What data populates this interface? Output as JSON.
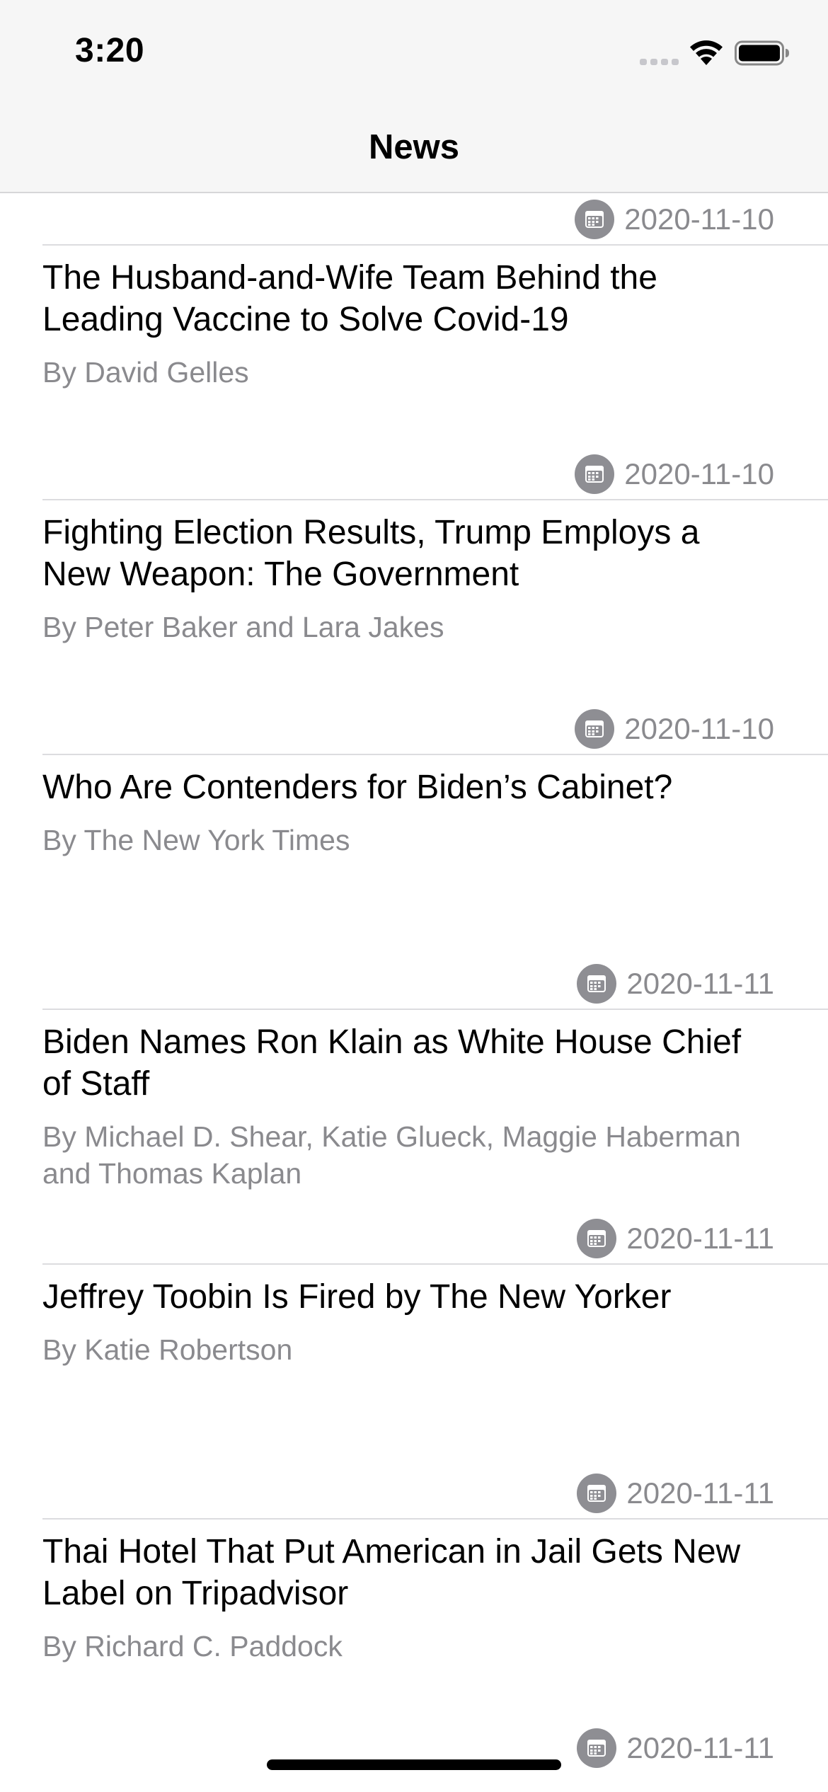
{
  "status_bar": {
    "time": "3:20",
    "icons": [
      "signal-icon",
      "wifi-icon",
      "battery-icon"
    ]
  },
  "nav": {
    "title": "News"
  },
  "colors": {
    "nav_background": "#f6f6f6",
    "separator": "#dcdcdf",
    "secondary_text": "#8a8a8e",
    "calendar_icon": "#8e8e93"
  },
  "news": [
    {
      "title": "",
      "byline": "",
      "date": "2020-11-10"
    },
    {
      "title": "The Husband-and-Wife Team Behind the Leading Vaccine to Solve Covid-19",
      "byline": "By David Gelles",
      "date": "2020-11-10"
    },
    {
      "title": "Fighting Election Results, Trump Employs a New Weapon: The Government",
      "byline": "By Peter Baker and Lara Jakes",
      "date": "2020-11-10"
    },
    {
      "title": "Who Are Contenders for Biden’s Cabinet?",
      "byline": "By The New York Times",
      "date": "2020-11-11"
    },
    {
      "title": "Biden Names Ron Klain as White House Chief of Staff",
      "byline": "By Michael D. Shear, Katie Glueck, Maggie Haberman and Thomas Kaplan",
      "date": "2020-11-11"
    },
    {
      "title": "Jeffrey Toobin Is Fired by The New Yorker",
      "byline": "By Katie Robertson",
      "date": "2020-11-11"
    },
    {
      "title": "Thai Hotel That Put American in Jail Gets New Label on Tripadvisor",
      "byline": "By Richard C. Paddock",
      "date": "2020-11-11"
    }
  ]
}
